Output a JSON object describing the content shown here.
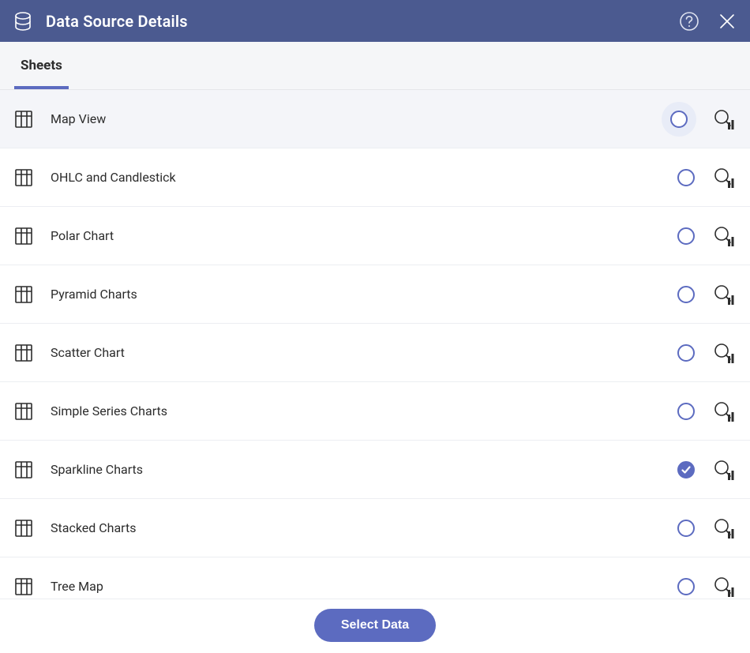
{
  "header": {
    "title": "Data Source Details"
  },
  "tabs": {
    "active": "Sheets"
  },
  "sheets": [
    {
      "label": "Map View",
      "selected": false,
      "hovered": true
    },
    {
      "label": "OHLC and Candlestick",
      "selected": false,
      "hovered": false
    },
    {
      "label": "Polar Chart",
      "selected": false,
      "hovered": false
    },
    {
      "label": "Pyramid Charts",
      "selected": false,
      "hovered": false
    },
    {
      "label": "Scatter Chart",
      "selected": false,
      "hovered": false
    },
    {
      "label": "Simple Series Charts",
      "selected": false,
      "hovered": false
    },
    {
      "label": "Sparkline Charts",
      "selected": true,
      "hovered": false
    },
    {
      "label": "Stacked Charts",
      "selected": false,
      "hovered": false
    },
    {
      "label": "Tree Map",
      "selected": false,
      "hovered": false
    }
  ],
  "footer": {
    "button_label": "Select Data"
  }
}
